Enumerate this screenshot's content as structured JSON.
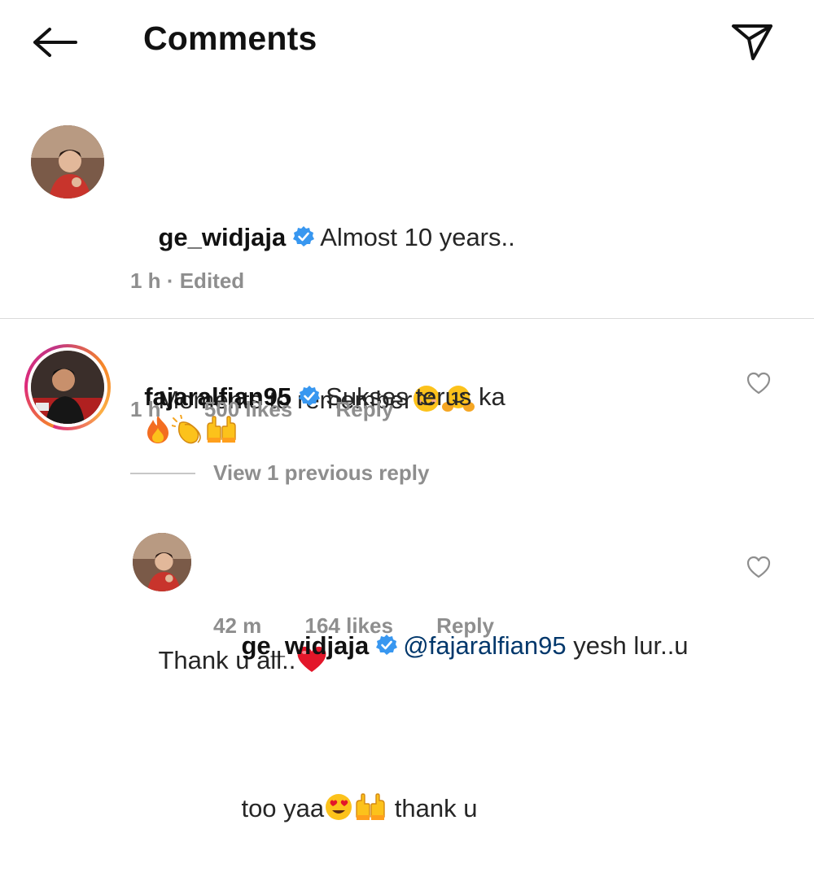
{
  "header": {
    "title": "Comments",
    "back_icon": "arrow-left-icon",
    "share_icon": "paper-plane-icon"
  },
  "caption": {
    "username": "ge_widjaja",
    "verified": true,
    "line1": "Almost 10 years..",
    "line2": "Moments to remember",
    "line3": "Thank u all..",
    "time": "1 h",
    "separator": "·",
    "edited": "Edited"
  },
  "comments": [
    {
      "username": "fajaralfian95",
      "verified": true,
      "text": "Sukses terus ka",
      "emojis": [
        "fire",
        "clapping-hands",
        "raising-hands"
      ],
      "time": "1 h",
      "likes": "500 likes",
      "reply_label": "Reply",
      "has_story": true
    }
  ],
  "view_replies_label": "View 1 previous reply",
  "replies": [
    {
      "username": "ge_widjaja",
      "verified": true,
      "mention": "@fajaralfian95",
      "text_line1": "yesh lur..u",
      "text_line2_a": "too yaa",
      "text_line2_b": "thank u",
      "time": "42 m",
      "likes": "164 likes",
      "reply_label": "Reply"
    }
  ],
  "colors": {
    "text": "#262626",
    "secondary": "#8e8e8e",
    "verified_blue": "#3897f0",
    "mention": "#00376b",
    "divider": "#dbdbdb"
  }
}
